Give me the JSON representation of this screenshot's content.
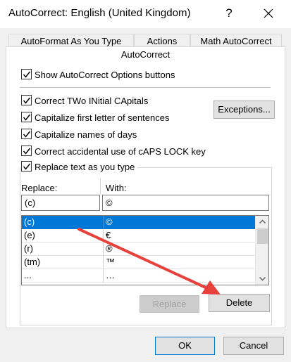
{
  "window": {
    "title": "AutoCorrect: English (United Kingdom)",
    "help_label": "?"
  },
  "tabs": [
    {
      "label": "AutoFormat As You Type"
    },
    {
      "label": "Actions"
    },
    {
      "label": "Math AutoCorrect"
    },
    {
      "label": "AutoCorrect"
    }
  ],
  "options": {
    "show_options_buttons": {
      "label": "Show AutoCorrect Options buttons",
      "checked": true
    },
    "correct_two_initial": {
      "label": "Correct TWo INitial CApitals",
      "checked": true
    },
    "capitalize_first": {
      "label": "Capitalize first letter of sentences",
      "checked": true
    },
    "capitalize_days": {
      "label": "Capitalize names of days",
      "checked": true
    },
    "caps_lock": {
      "label": "Correct accidental use of cAPS LOCK key",
      "checked": true
    },
    "replace_text": {
      "label": "Replace text as you type",
      "checked": true
    }
  },
  "exceptions_label": "Exceptions...",
  "replace_header": "Replace:",
  "with_header": "With:",
  "replace_value": "(c)",
  "with_value": "©",
  "list": [
    {
      "replace": "(c)",
      "with": "©",
      "selected": true
    },
    {
      "replace": "(e)",
      "with": "€",
      "selected": false
    },
    {
      "replace": "(r)",
      "with": "®",
      "selected": false
    },
    {
      "replace": "(tm)",
      "with": "™",
      "selected": false
    },
    {
      "replace": "...",
      "with": "…",
      "selected": false
    }
  ],
  "buttons": {
    "replace": "Replace",
    "delete": "Delete",
    "ok": "OK",
    "cancel": "Cancel"
  },
  "colors": {
    "selection": "#0078d7",
    "annotation_arrow": "#e8413c"
  }
}
